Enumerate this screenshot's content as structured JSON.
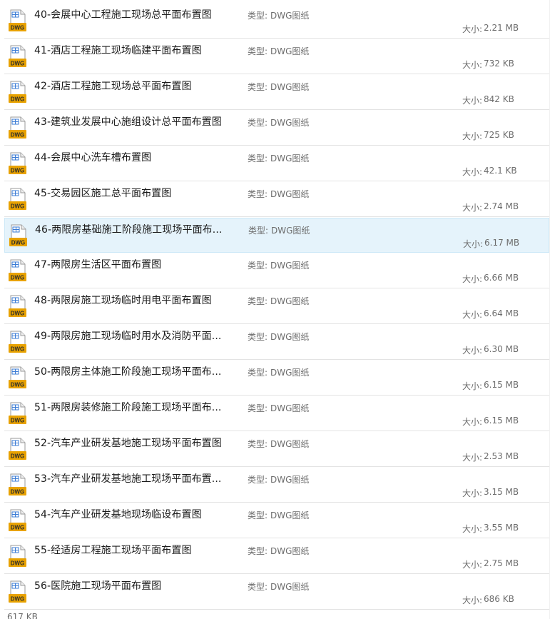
{
  "list": {
    "type_label": "类型:",
    "size_label": "大小:",
    "selected_index": 6,
    "items": [
      {
        "name": "40-会展中心工程施工现场总平面布置图",
        "type": "DWG图纸",
        "size": "2.21 MB"
      },
      {
        "name": "41-酒店工程施工现场临建平面布置图",
        "type": "DWG图纸",
        "size": "732 KB"
      },
      {
        "name": "42-酒店工程施工现场总平面布置图",
        "type": "DWG图纸",
        "size": "842 KB"
      },
      {
        "name": "43-建筑业发展中心施组设计总平面布置图",
        "type": "DWG图纸",
        "size": "725 KB"
      },
      {
        "name": "44-会展中心洗车槽布置图",
        "type": "DWG图纸",
        "size": "42.1 KB"
      },
      {
        "name": "45-交易园区施工总平面布置图",
        "type": "DWG图纸",
        "size": "2.74 MB"
      },
      {
        "name": "46-两限房基础施工阶段施工现场平面布...",
        "type": "DWG图纸",
        "size": "6.17 MB"
      },
      {
        "name": "47-两限房生活区平面布置图",
        "type": "DWG图纸",
        "size": "6.66 MB"
      },
      {
        "name": "48-两限房施工现场临时用电平面布置图",
        "type": "DWG图纸",
        "size": "6.64 MB"
      },
      {
        "name": "49-两限房施工现场临时用水及消防平面...",
        "type": "DWG图纸",
        "size": "6.30 MB"
      },
      {
        "name": "50-两限房主体施工阶段施工现场平面布...",
        "type": "DWG图纸",
        "size": "6.15 MB"
      },
      {
        "name": "51-两限房装修施工阶段施工现场平面布...",
        "type": "DWG图纸",
        "size": "6.15 MB"
      },
      {
        "name": "52-汽车产业研发基地施工现场平面布置图",
        "type": "DWG图纸",
        "size": "2.53 MB"
      },
      {
        "name": "53-汽车产业研发基地施工现场平面布置...",
        "type": "DWG图纸",
        "size": "3.15 MB"
      },
      {
        "name": "54-汽车产业研发基地现场临设布置图",
        "type": "DWG图纸",
        "size": "3.55 MB"
      },
      {
        "name": "55-经适房工程施工现场平面布置图",
        "type": "DWG图纸",
        "size": "2.75 MB"
      },
      {
        "name": "56-医院施工现场平面布置图",
        "type": "DWG图纸",
        "size": "686 KB"
      }
    ],
    "partial_size": "617 KB",
    "icon": {
      "name": "dwg-file-icon",
      "text": "DWG",
      "badge_color": "#e8a200",
      "badge_text_color": "#2b2b2b"
    }
  }
}
